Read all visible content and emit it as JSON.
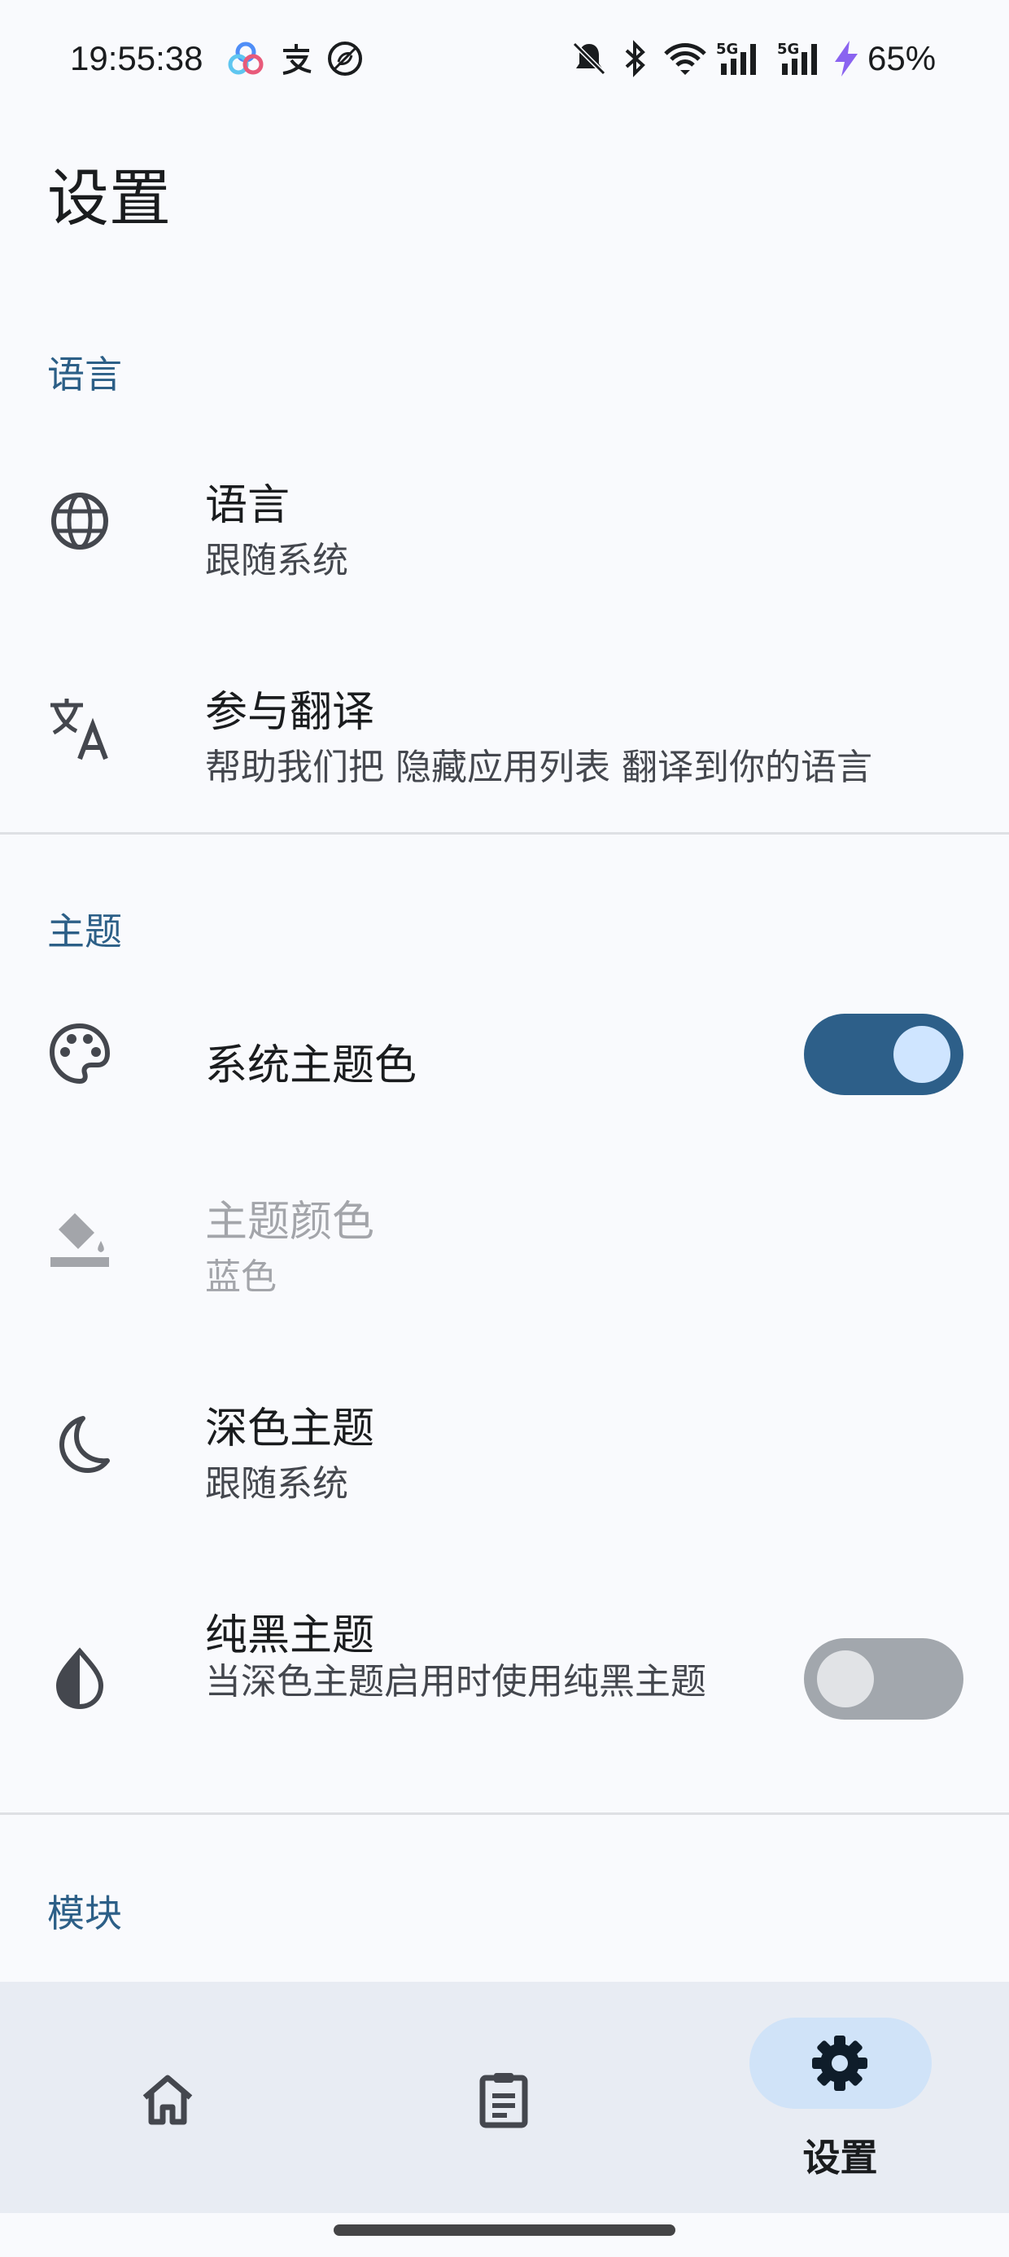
{
  "status_bar": {
    "time": "19:55:38",
    "battery": "65%",
    "icons": [
      "baidu-netdisk-icon",
      "alipay-icon",
      "no-sync-icon",
      "mute-icon",
      "bluetooth-icon",
      "wifi-icon",
      "signal-5g-icon",
      "signal-5g-icon",
      "charging-icon"
    ]
  },
  "page": {
    "title": "设置"
  },
  "sections": {
    "language": {
      "header": "语言",
      "items": [
        {
          "title": "语言",
          "subtitle": "跟随系统",
          "icon": "globe-icon"
        },
        {
          "title": "参与翻译",
          "subtitle": "帮助我们把 隐藏应用列表 翻译到你的语言",
          "icon": "translate-icon"
        }
      ]
    },
    "theme": {
      "header": "主题",
      "items": [
        {
          "title": "系统主题色",
          "icon": "palette-icon",
          "switch": "on"
        },
        {
          "title": "主题颜色",
          "subtitle": "蓝色",
          "icon": "paint-bucket-icon",
          "disabled": true
        },
        {
          "title": "深色主题",
          "subtitle": "跟随系统",
          "icon": "moon-icon"
        },
        {
          "title": "纯黑主题",
          "subtitle": "当深色主题启用时使用纯黑主题",
          "icon": "contrast-icon",
          "switch": "off"
        }
      ]
    },
    "module": {
      "header": "模块"
    }
  },
  "bottom_nav": {
    "items": [
      {
        "icon": "home-icon",
        "label": ""
      },
      {
        "icon": "clipboard-icon",
        "label": ""
      },
      {
        "icon": "gear-icon",
        "label": "设置",
        "active": true
      }
    ]
  },
  "colors": {
    "accent": "#2d5f89",
    "section_header": "#2c5f87",
    "background": "#f9fafd",
    "nav_background": "#e8ecf3",
    "nav_indicator": "#d0e3f8"
  }
}
